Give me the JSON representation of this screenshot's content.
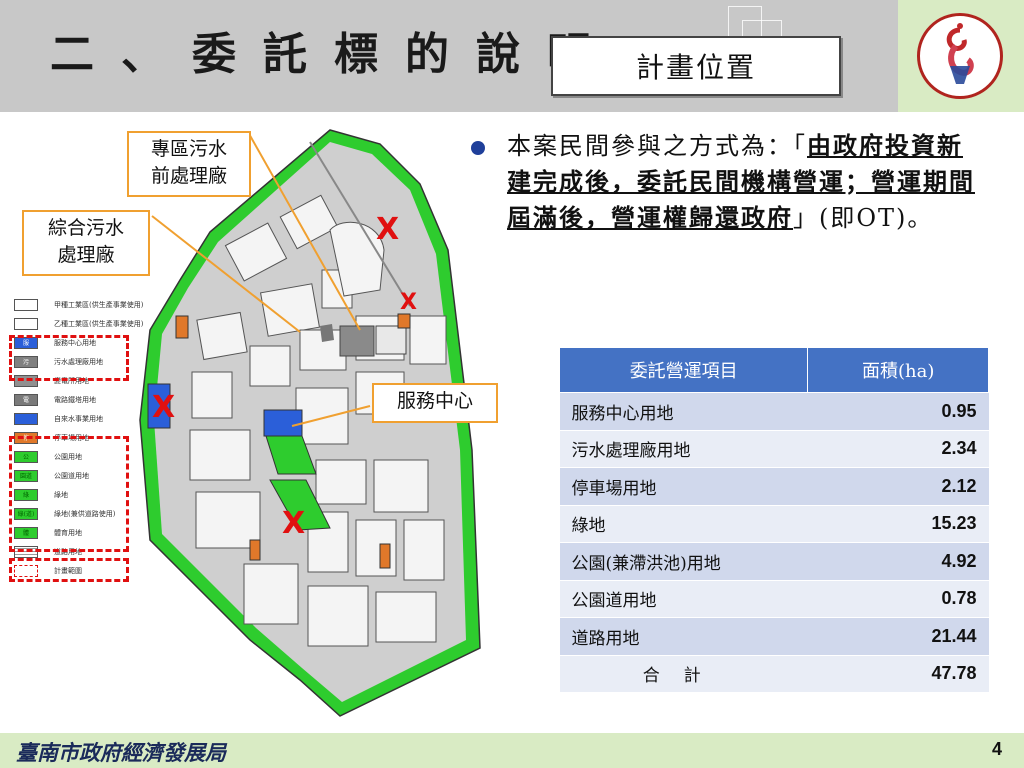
{
  "header": {
    "title": "二、委託標的說明",
    "subtitle": "計畫位置"
  },
  "colors": {
    "header_bg": "#c8c8c8",
    "logo_band": "#d9ebc4",
    "table_header": "#4472c4",
    "callout_border": "#f0a030",
    "highlight_red": "#e01010",
    "green_land": "#2ecc2e"
  },
  "icons": [
    "logo-icon",
    "bullet-icon"
  ],
  "map": {
    "callouts": {
      "dedicated_sewage": [
        "專區污水",
        "前處理廠"
      ],
      "combined_sewage": [
        "綜合污水",
        "處理廠"
      ],
      "service_center": [
        "服務中心"
      ]
    },
    "x_marks": [
      "X",
      "X",
      "X",
      "X"
    ],
    "legend": [
      {
        "swatch": "",
        "label": "甲種工業區(供生產事業使用)",
        "color": "#ffffff"
      },
      {
        "swatch": "",
        "label": "乙種工業區(供生產事業使用)",
        "color": "#ffffff"
      },
      {
        "swatch": "服",
        "label": "服務中心用地",
        "color": "#2b5fd9"
      },
      {
        "swatch": "污",
        "label": "污水處理廠用地",
        "color": "#808080"
      },
      {
        "swatch": "",
        "label": "變電所用地",
        "color": "#909090"
      },
      {
        "swatch": "電",
        "label": "電路鐵塔用地",
        "color": "#7a7a7a"
      },
      {
        "swatch": "",
        "label": "自來水事業用地",
        "color": "#2b5fd9"
      },
      {
        "swatch": "停",
        "label": "停車場用地",
        "color": "#e0782a"
      },
      {
        "swatch": "公",
        "label": "公園用地",
        "color": "#2ecc2e"
      },
      {
        "swatch": "園道",
        "label": "公園道用地",
        "color": "#2ecc2e"
      },
      {
        "swatch": "綠",
        "label": "綠地",
        "color": "#2ecc2e"
      },
      {
        "swatch": "綠(道)",
        "label": "綠地(兼供道路使用)",
        "color": "#2ecc2e"
      },
      {
        "swatch": "體",
        "label": "體育用地",
        "color": "#2ecc2e"
      },
      {
        "swatch": "",
        "label": "道路用地",
        "color": "#ffffff"
      },
      {
        "swatch": "",
        "label": "計畫範圍",
        "color": "#ffffff"
      }
    ]
  },
  "bullet": {
    "prefix": "本案民間參與之方式為：「",
    "emphasis": "由政府投資新建完成後，委託民間機構營運；營運期間屆滿後，營運權歸還政府",
    "suffix": "」(即OT)。"
  },
  "table": {
    "headers": [
      "委託營運項目",
      "面積(ha)"
    ],
    "rows": [
      {
        "item": "服務中心用地",
        "area": "0.95"
      },
      {
        "item": "污水處理廠用地",
        "area": "2.34"
      },
      {
        "item": "停車場用地",
        "area": "2.12"
      },
      {
        "item": "綠地",
        "area": "15.23"
      },
      {
        "item": "公園(兼滯洪池)用地",
        "area": "4.92"
      },
      {
        "item": "公園道用地",
        "area": "0.78"
      },
      {
        "item": "道路用地",
        "area": "21.44"
      }
    ],
    "total": {
      "item": "合計",
      "area": "47.78"
    }
  },
  "footer": {
    "org": "臺南市政府經濟發展局",
    "page": "4"
  }
}
